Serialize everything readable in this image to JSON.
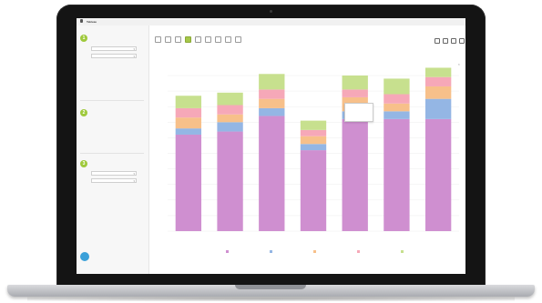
{
  "app": {
    "title": "Tableau"
  },
  "menubar": {
    "status_text": ""
  },
  "sidebar": {
    "add_link": "",
    "steps": [
      {
        "number": "1",
        "title": "",
        "fields": [
          "",
          ""
        ]
      },
      {
        "number": "2",
        "title": "",
        "fields": [
          "",
          "",
          "",
          ""
        ]
      },
      {
        "number": "3",
        "title": "",
        "fields": [
          "",
          ""
        ]
      }
    ],
    "send_button": ""
  },
  "main": {
    "breadcrumb": "",
    "chart_caption": "",
    "tooltip_lines": [
      "",
      "",
      ""
    ]
  },
  "toolbar": {
    "icons": [
      "table-icon",
      "number-icon",
      "line-chart-icon",
      "bar-chart-icon",
      "stacked-bar-icon",
      "area-chart-icon",
      "pie-chart-icon",
      "map-icon",
      "scatter-icon"
    ],
    "right_icons": [
      "save-icon",
      "share-icon",
      "filter-icon",
      "export-icon"
    ]
  },
  "colors": {
    "accent": "#9fc93c",
    "segment_bottom": "#cf8fd0",
    "segment_blue": "#94b6e4",
    "segment_orange": "#f7c08a",
    "segment_pink": "#f6a8b8",
    "segment_green": "#c7e08e",
    "send_button": "#3aa0d9"
  },
  "chart_data": {
    "type": "bar",
    "stacked": true,
    "categories": [
      "",
      "",
      "",
      "",
      "",
      "",
      ""
    ],
    "series": [
      {
        "values": [
          62,
          64,
          74,
          52,
          72,
          72,
          72
        ]
      },
      {
        "values": [
          4,
          6,
          5,
          4,
          5,
          5,
          13
        ]
      },
      {
        "values": [
          7,
          5,
          6,
          5,
          9,
          5,
          8
        ]
      },
      {
        "values": [
          6,
          6,
          6,
          4,
          5,
          6,
          6
        ]
      },
      {
        "values": [
          8,
          8,
          10,
          6,
          9,
          10,
          6
        ]
      }
    ],
    "ylim": [
      0,
      100
    ],
    "y_ticks": [
      "",
      "",
      "",
      "",
      "",
      "",
      "",
      "",
      "",
      "",
      ""
    ],
    "legend_labels": [
      "",
      "",
      "",
      "",
      ""
    ],
    "legend_title": "",
    "grid": true,
    "legend_placement": "bottom"
  }
}
